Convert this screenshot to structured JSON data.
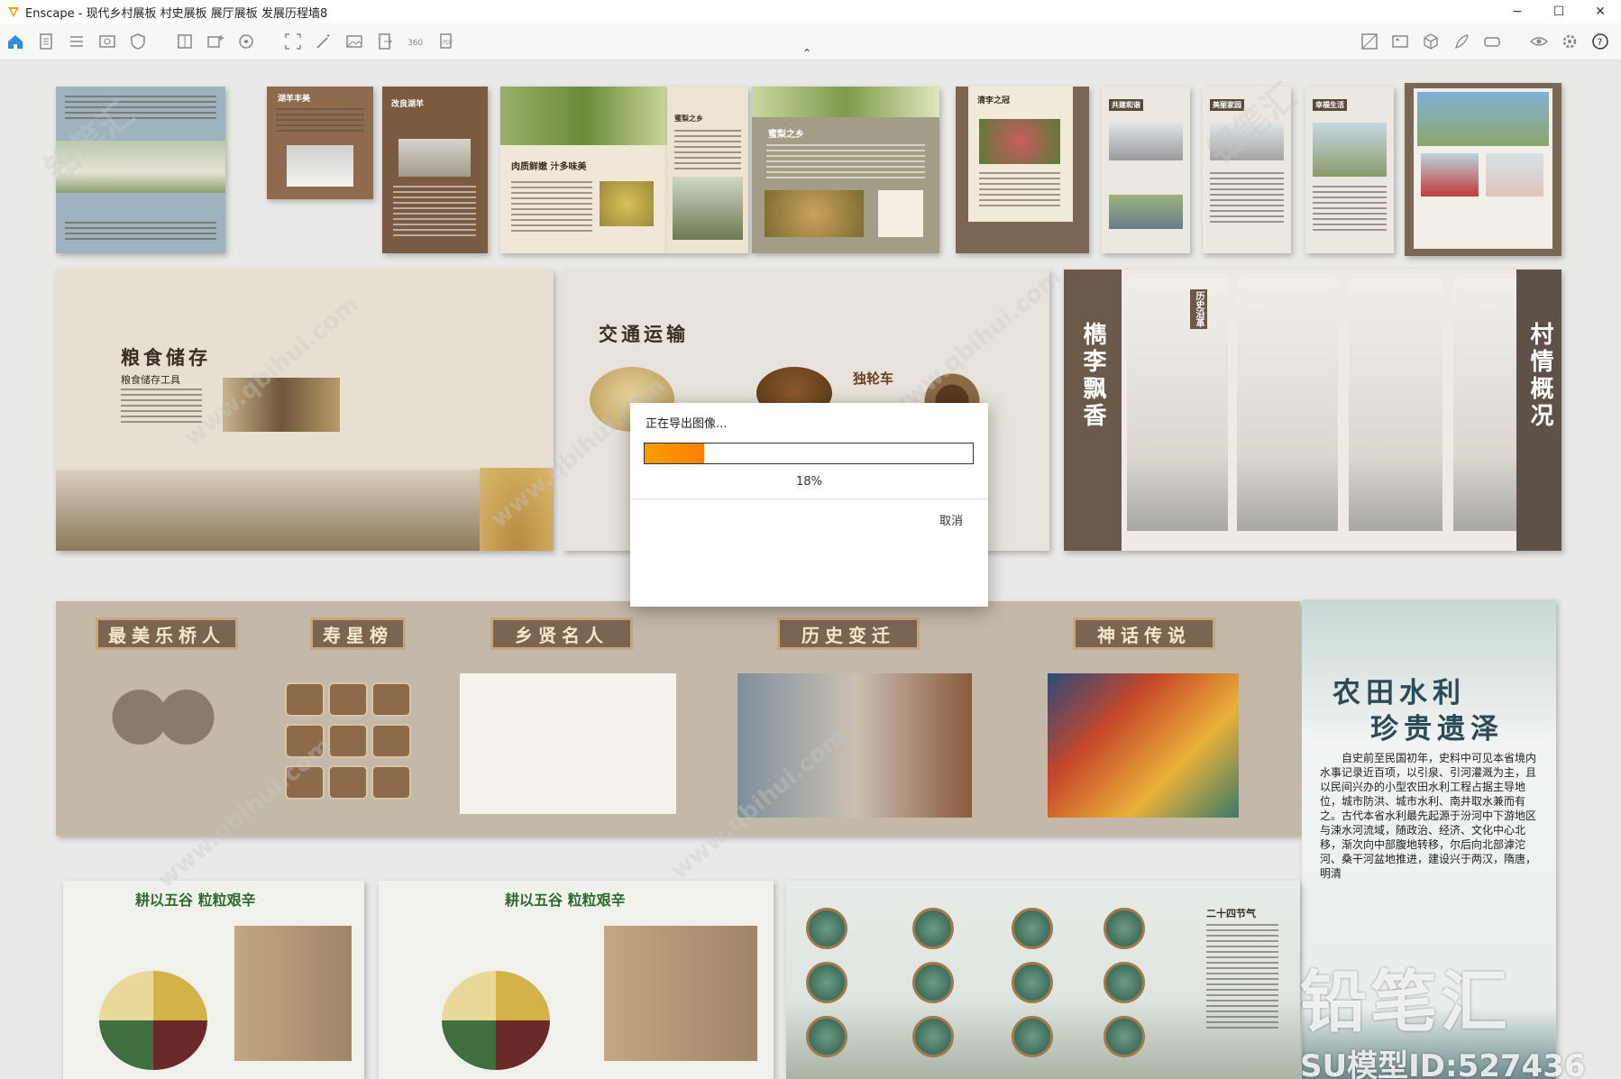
{
  "window": {
    "title": "Enscape - 现代乡村展板 村史展板 展厅展板 发展历程墙8",
    "minimize": "−",
    "maximize": "☐",
    "close": "✕"
  },
  "toolbar": {
    "left_icons": [
      "home-icon",
      "document-icon",
      "list-icon",
      "visual-settings-icon",
      "shield-icon",
      "book-icon",
      "add-view-icon",
      "asset-library-icon",
      "screenshot-icon",
      "magic-wand-icon",
      "image-icon",
      "export-document-icon",
      "panorama-icon",
      "batch-export-icon"
    ],
    "right_icons": [
      "material-icon",
      "gallery-icon",
      "cube-icon",
      "feather-icon",
      "vr-headset-icon",
      "eye-icon",
      "settings-icon",
      "help-icon"
    ],
    "help_label": "?",
    "collapse_glyph": "⌃"
  },
  "scene": {
    "row1": {
      "board_a": "湖羊丰美",
      "board_b": "改良湖羊",
      "board_c": "肉质鲜嫩 汁多味美",
      "board_d": "蜜梨之乡",
      "board_e": "蜜梨之乡",
      "board_f": "清李之冠",
      "board_g": "共建和谐",
      "board_h": "美丽家园",
      "board_i": "幸福生活"
    },
    "row2": {
      "grain": {
        "title": "粮食储存",
        "subtitle": "粮食储存工具"
      },
      "transport": {
        "title": "交通运输",
        "cart_label": "独轮车"
      },
      "plum": {
        "title": "檇李飘香",
        "tag": "历史沿革"
      },
      "village": {
        "title": "村情概况"
      }
    },
    "row3": {
      "plaques": [
        "最美乐桥人",
        "寿星榜",
        "乡贤名人",
        "历史变迁",
        "神话传说"
      ],
      "irrigation": {
        "title_line1": "农田水利",
        "title_line2": "珍贵遗泽",
        "body": "自史前至民国初年，史料中可见本省境内水事记录近百项，以引泉、引河灌溉为主，且以民间兴办的小型农田水利工程占据主导地位，城市防洪、城市水利、南井取水兼而有之。古代本省水利最先起源于汾河中下游地区与涑水河流域，随政治、经济、文化中心北移，渐次向中部腹地转移，尔后向北部滹沱河、桑干河盆地推进，建设兴于两汉，隋唐，明清"
      }
    },
    "row4": {
      "grains_a": "耕以五谷 粒粒艰辛",
      "grains_b": "耕以五谷 粒粒艰辛",
      "solar_terms": "二十四节气"
    }
  },
  "dialog": {
    "title": "正在导出图像...",
    "progress": 0.18,
    "percent_label": "18%",
    "cancel": "取消"
  },
  "watermark": {
    "brand": "铅笔汇",
    "model_id": "SU模型ID:527436",
    "url": "www.qbihui.com"
  }
}
